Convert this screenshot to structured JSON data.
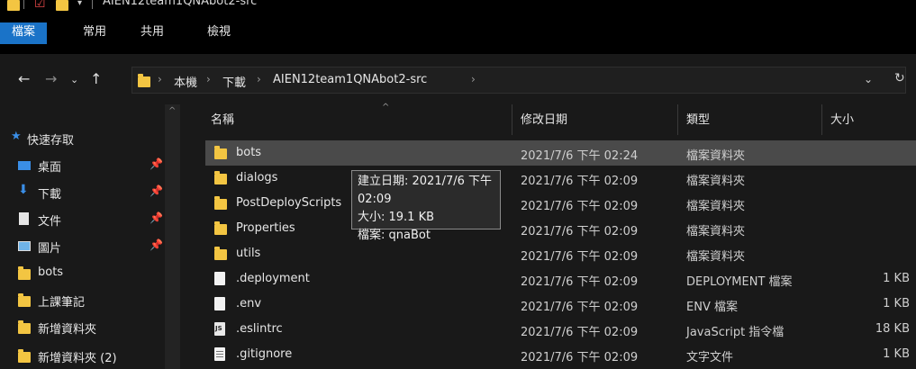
{
  "window": {
    "title": "AIEN12team1QNAbot2-src"
  },
  "ribbon": {
    "tabs": [
      "檔案",
      "常用",
      "共用",
      "檢視"
    ]
  },
  "address": {
    "crumbs": [
      "本機",
      "下載",
      "AIEN12team1QNAbot2-src"
    ]
  },
  "sidebar": {
    "quick_access": "快速存取",
    "items": [
      {
        "label": "桌面",
        "icon": "desktop-icon",
        "pinned": true
      },
      {
        "label": "下載",
        "icon": "download-icon",
        "pinned": true
      },
      {
        "label": "文件",
        "icon": "document-icon",
        "pinned": true
      },
      {
        "label": "圖片",
        "icon": "picture-icon",
        "pinned": true
      },
      {
        "label": "bots",
        "icon": "folder-icon",
        "pinned": false
      },
      {
        "label": "上課筆記",
        "icon": "folder-icon",
        "pinned": false
      },
      {
        "label": "新增資料夾",
        "icon": "folder-icon",
        "pinned": false
      },
      {
        "label": "新增資料夾 (2)",
        "icon": "folder-icon",
        "pinned": false
      }
    ]
  },
  "columns": {
    "name": "名稱",
    "date": "修改日期",
    "type": "類型",
    "size": "大小"
  },
  "files": [
    {
      "name": "bots",
      "date": "2021/7/6 下午 02:24",
      "type": "檔案資料夾",
      "size": "",
      "icon": "folder-icon",
      "selected": true
    },
    {
      "name": "dialogs",
      "date": "2021/7/6 下午 02:09",
      "type": "檔案資料夾",
      "size": "",
      "icon": "folder-icon"
    },
    {
      "name": "PostDeployScripts",
      "date": "2021/7/6 下午 02:09",
      "type": "檔案資料夾",
      "size": "",
      "icon": "folder-icon"
    },
    {
      "name": "Properties",
      "date": "2021/7/6 下午 02:09",
      "type": "檔案資料夾",
      "size": "",
      "icon": "folder-icon"
    },
    {
      "name": "utils",
      "date": "2021/7/6 下午 02:09",
      "type": "檔案資料夾",
      "size": "",
      "icon": "folder-icon"
    },
    {
      "name": ".deployment",
      "date": "2021/7/6 下午 02:09",
      "type": "DEPLOYMENT 檔案",
      "size": "1 KB",
      "icon": "file-icon"
    },
    {
      "name": ".env",
      "date": "2021/7/6 下午 02:09",
      "type": "ENV 檔案",
      "size": "1 KB",
      "icon": "file-icon"
    },
    {
      "name": ".eslintrc",
      "date": "2021/7/6 下午 02:09",
      "type": "JavaScript 指令檔",
      "size": "18 KB",
      "icon": "javascript-file-icon"
    },
    {
      "name": ".gitignore",
      "date": "2021/7/6 下午 02:09",
      "type": "文字文件",
      "size": "1 KB",
      "icon": "text-file-icon"
    }
  ],
  "tooltip": {
    "line1": "建立日期: 2021/7/6 下午 02:09",
    "line2": "大小: 19.1 KB",
    "line3": "檔案: qnaBot"
  }
}
